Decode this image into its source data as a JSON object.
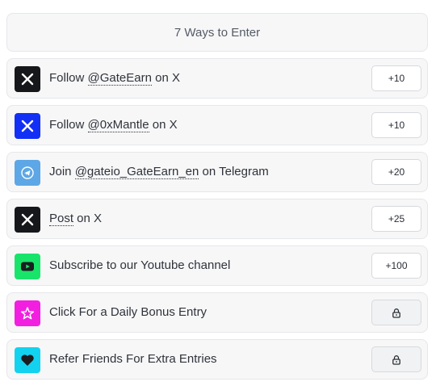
{
  "header": {
    "title": "7 Ways to Enter"
  },
  "colors": {
    "x_icon": "#15171a",
    "mantle_icon": "#1230f5",
    "telegram_icon": "#5da7e6",
    "youtube_icon": "#19e46a",
    "daily_icon": "#f21fe0",
    "refer_icon": "#12d2f0"
  },
  "entries": [
    {
      "icon": "x-logo",
      "prefix": "Follow ",
      "handle": "@GateEarn",
      "suffix": " on X",
      "points": "+10"
    },
    {
      "icon": "x-logo",
      "prefix": "Follow ",
      "handle": "@0xMantle",
      "suffix": " on X",
      "points": "+10"
    },
    {
      "icon": "telegram-logo",
      "prefix": "Join ",
      "handle": "@gateio_GateEarn_en",
      "suffix": " on Telegram",
      "points": "+20"
    },
    {
      "icon": "x-logo",
      "prefix": "",
      "handle": "Post",
      "suffix": " on X",
      "points": "+25"
    },
    {
      "icon": "youtube-logo",
      "prefix": "Subscribe to our Youtube channel",
      "handle": "",
      "suffix": "",
      "points": "+100"
    },
    {
      "icon": "star",
      "prefix": "Click For a Daily Bonus Entry",
      "handle": "",
      "suffix": "",
      "points": "lock-icon"
    },
    {
      "icon": "heart",
      "prefix": "Refer Friends For Extra Entries",
      "handle": "",
      "suffix": "",
      "points": "lock-icon"
    }
  ]
}
